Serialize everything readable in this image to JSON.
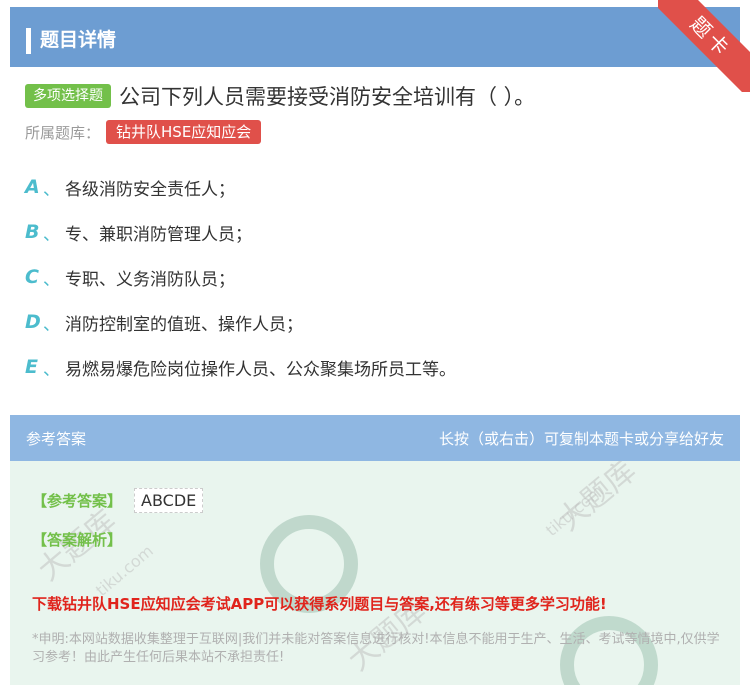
{
  "header": {
    "title": "题目详情"
  },
  "ribbon": {
    "text": "题卡"
  },
  "question": {
    "type_badge": "多项选择题",
    "text": "公司下列人员需要接受消防安全培训有（ ）。",
    "bank_label": "所属题库：",
    "bank_name": "钻井队HSE应知应会"
  },
  "options": [
    {
      "letter": "A",
      "sep": "、",
      "text": "各级消防安全责任人；"
    },
    {
      "letter": "B",
      "sep": "、",
      "text": "专、兼职消防管理人员；"
    },
    {
      "letter": "C",
      "sep": "、",
      "text": "专职、义务消防队员；"
    },
    {
      "letter": "D",
      "sep": "、",
      "text": "消防控制室的值班、操作人员；"
    },
    {
      "letter": "E",
      "sep": "、",
      "text": "易燃易爆危险岗位操作人员、公众聚集场所员工等。"
    }
  ],
  "answer": {
    "section_label": "参考答案",
    "hint": "长按（或右击）可复制本题卡或分享给好友",
    "answer_label": "【参考答案】",
    "answer_value": "ABCDE",
    "explain_label": "【答案解析】",
    "promo": "下载钻井队HSE应知应会考试APP可以获得系列题目与答案,还有练习等更多学习功能!",
    "disclaimer": "*申明:本网站数据收集整理于互联网|我们并未能对答案信息进行核对!本信息不能用于生产、生活、考试等情境中,仅供学习参考！由此产生任何后果本站不承担责任!"
  },
  "watermark": {
    "text": "大题库",
    "site": "tiku.com"
  },
  "colors": {
    "header": "#6d9dd2",
    "accent_green": "#73c04a",
    "accent_red": "#e0504a",
    "option_letter": "#4cbccd"
  }
}
